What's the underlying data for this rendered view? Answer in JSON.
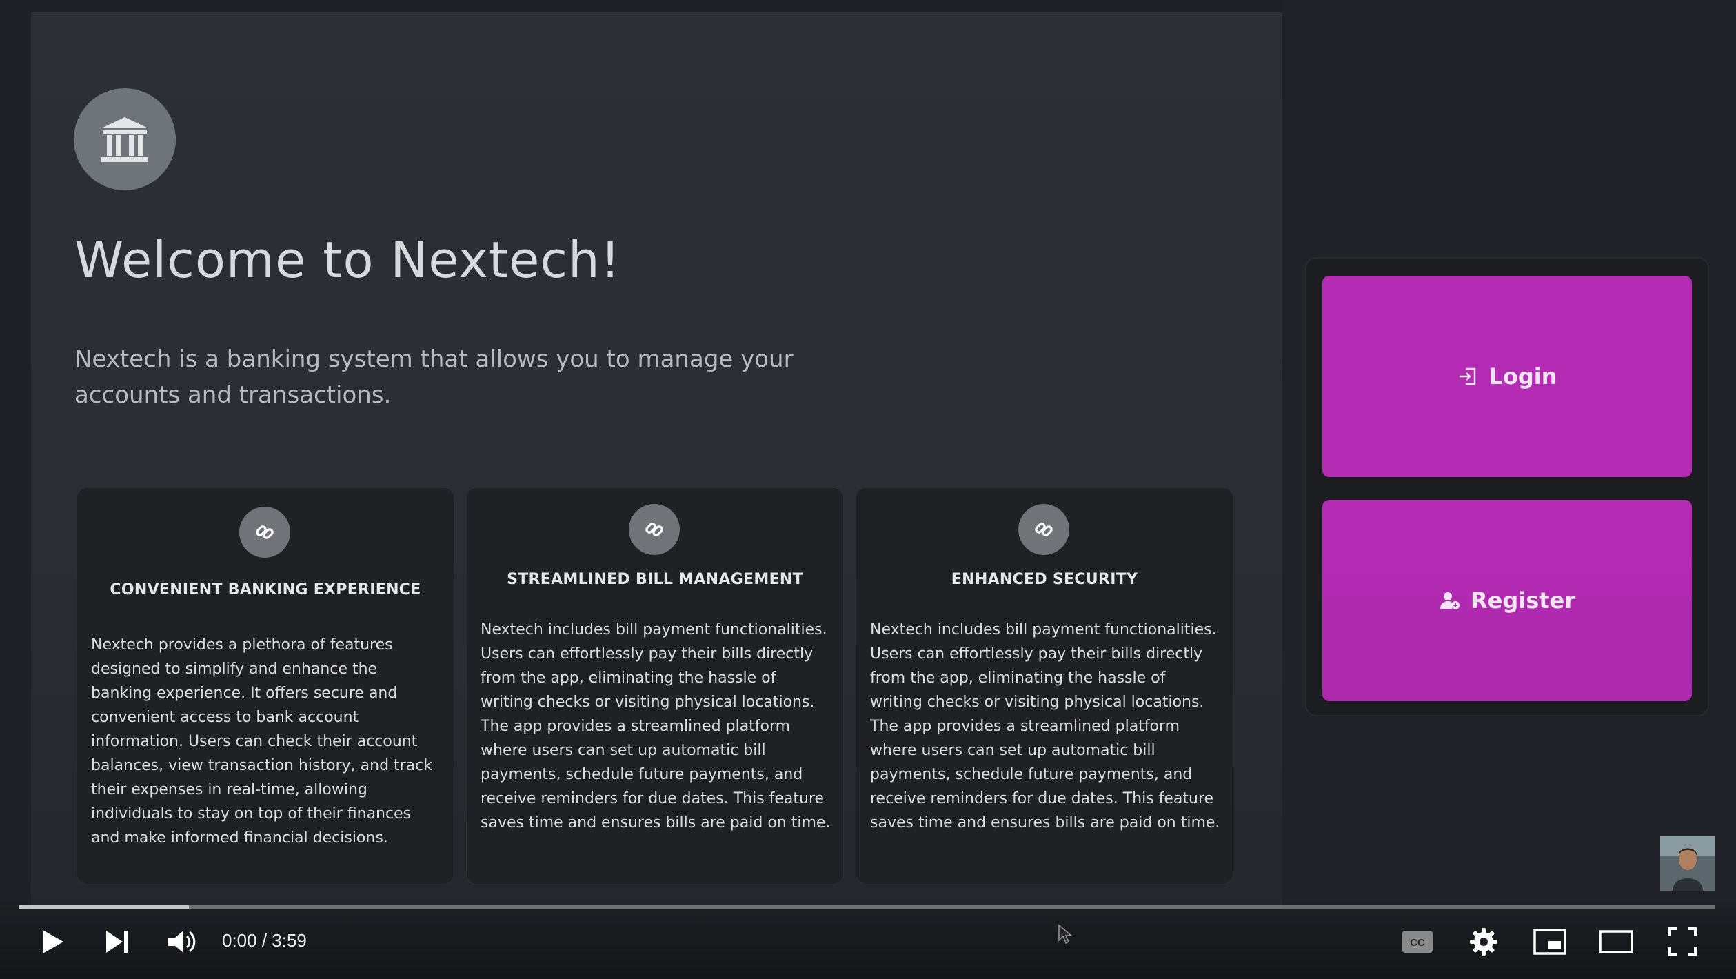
{
  "app": {
    "title": "Welcome to Nextech!",
    "description": "Nextech is a banking system that allows you to manage your accounts and transactions.",
    "logo_icon": "bank-icon"
  },
  "features": [
    {
      "icon": "link-icon",
      "title": "CONVENIENT BANKING EXPERIENCE",
      "text": "Nextech provides a plethora of features designed to simplify and enhance the banking experience. It offers secure and convenient access to bank account information. Users can check their account balances, view transaction history, and track their expenses in real-time, allowing individuals to stay on top of their finances and make informed financial decisions."
    },
    {
      "icon": "link-icon",
      "title": "STREAMLINED BILL MANAGEMENT",
      "text": "Nextech includes bill payment functionalities. Users can effortlessly pay their bills directly from the app, eliminating the hassle of writing checks or visiting physical locations. The app provides a streamlined platform where users can set up automatic bill payments, schedule future payments, and receive reminders for due dates. This feature saves time and ensures bills are paid on time."
    },
    {
      "icon": "link-icon",
      "title": "ENHANCED SECURITY",
      "text": "Nextech includes bill payment functionalities. Users can effortlessly pay their bills directly from the app, eliminating the hassle of writing checks or visiting physical locations. The app provides a streamlined platform where users can set up automatic bill payments, schedule future payments, and receive reminders for due dates. This feature saves time and ensures bills are paid on time."
    }
  ],
  "auth": {
    "login_label": "Login",
    "login_icon": "login-icon",
    "register_label": "Register",
    "register_icon": "user-add-icon",
    "accent_color": "#b42bb4"
  },
  "player": {
    "time": "0:00 / 3:59",
    "progress": 0,
    "buffered": 0.1,
    "icons": [
      "play-icon",
      "next-icon",
      "volume-icon",
      "captions-icon",
      "settings-icon",
      "miniplayer-icon",
      "theater-icon",
      "fullscreen-icon"
    ]
  }
}
